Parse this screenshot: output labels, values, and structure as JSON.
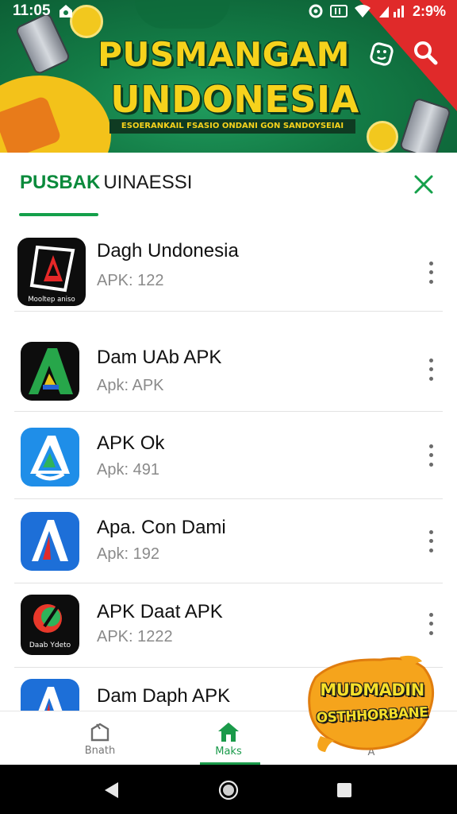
{
  "status_bar": {
    "time": "11:05",
    "battery_text": "2:9%"
  },
  "banner": {
    "title_line1": "PUSMANGAM",
    "title_line2": "UNDONESIA",
    "tagline": "ESOERANKAIL FSASIO ONDANI GON SANDOYSEIAI",
    "colors": {
      "green": "#137a45",
      "yellow": "#f6d21c",
      "red": "#e02a2a"
    }
  },
  "sheet": {
    "title_accent": "PUSBAK",
    "title_rest": "UINAESSI"
  },
  "apps": [
    {
      "name": "Dagh Undonesia",
      "sub": "APK: 122",
      "icon": "black-a-logo-icon",
      "icon_caption": "Mooltep aniso"
    },
    {
      "name": "Dam UAb APK",
      "sub": "Apk: APK",
      "icon": "green-a-logo-icon"
    },
    {
      "name": "APK Ok",
      "sub": "Apk: 491",
      "icon": "blue-a-outline-icon"
    },
    {
      "name": "Apa. Con Dami",
      "sub": "Apk: 192",
      "icon": "blue-red-a-icon"
    },
    {
      "name": "APK Daat APK",
      "sub": "APK: 1222",
      "icon": "black-circle-logo-icon",
      "icon_caption": "Daab Ydeto"
    },
    {
      "name": "Dam Daph APK",
      "sub": "",
      "icon": "blue-red-a-icon-partial"
    }
  ],
  "bottom_nav": {
    "items": [
      {
        "label": "Bnath",
        "icon": "box-outline-icon"
      },
      {
        "label": "Maks",
        "icon": "home-icon",
        "active": true
      },
      {
        "label": "A",
        "icon": ""
      }
    ]
  },
  "promo": {
    "line1": "MUDMADIN",
    "line2": "OSTHHORBANE"
  },
  "system_nav": [
    "back-icon",
    "home-circle-icon",
    "recents-square-icon"
  ]
}
